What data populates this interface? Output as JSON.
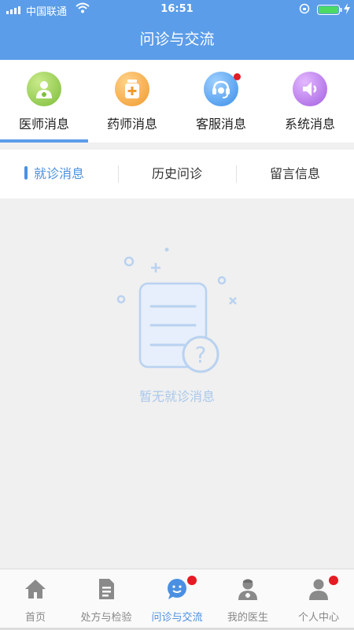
{
  "status_bar": {
    "carrier": "中国联通",
    "time": "16:51",
    "icons": [
      "signal-icon",
      "wifi-icon",
      "rotation-lock-icon",
      "battery-icon",
      "charging-icon"
    ]
  },
  "header": {
    "title": "问诊与交流"
  },
  "message_types": [
    {
      "label": "医师消息",
      "icon": "doctor-icon",
      "color": "#8bc34a",
      "active": true,
      "badge": false
    },
    {
      "label": "药师消息",
      "icon": "medicine-bottle-icon",
      "color": "#f5a623",
      "active": false,
      "badge": false
    },
    {
      "label": "客服消息",
      "icon": "headset-icon",
      "color": "#4a90e2",
      "active": false,
      "badge": true
    },
    {
      "label": "系统消息",
      "icon": "speaker-icon",
      "color": "#b070e0",
      "active": false,
      "badge": false
    }
  ],
  "sub_tabs": [
    {
      "label": "就诊消息",
      "active": true
    },
    {
      "label": "历史问诊",
      "active": false
    },
    {
      "label": "留言信息",
      "active": false
    }
  ],
  "empty_state": {
    "text": "暂无就诊消息",
    "icon": "empty-document-question-icon"
  },
  "tab_bar": [
    {
      "label": "首页",
      "icon": "home-icon",
      "active": false,
      "badge": false
    },
    {
      "label": "处方与检验",
      "icon": "document-icon",
      "active": false,
      "badge": false
    },
    {
      "label": "问诊与交流",
      "icon": "chat-bubble-icon",
      "active": true,
      "badge": true
    },
    {
      "label": "我的医生",
      "icon": "doctor-icon",
      "active": false,
      "badge": false
    },
    {
      "label": "个人中心",
      "icon": "person-icon",
      "active": false,
      "badge": true
    }
  ],
  "colors": {
    "primary": "#5b9de9",
    "active_text": "#4a90e2",
    "badge": "#e51c23",
    "empty_text": "#a9c8ec"
  }
}
